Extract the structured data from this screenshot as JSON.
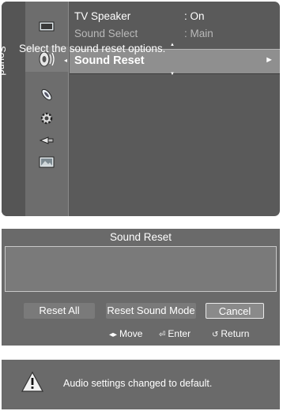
{
  "menu": {
    "category": "Sound",
    "icons": [
      "picture-icon",
      "sound-icon",
      "channel-icon",
      "setup-icon",
      "input-icon",
      "application-icon"
    ],
    "active_icon": "sound-icon",
    "items": [
      {
        "label": "TV Speaker",
        "value": ": On"
      },
      {
        "label": "Sound Select",
        "value": ": Main"
      }
    ],
    "selected": {
      "label": "Sound Reset",
      "arrow": "►"
    }
  },
  "dialog": {
    "title": "Sound Reset",
    "message": "Select the sound reset options.",
    "buttons": [
      "Reset All",
      "Reset Sound Mode",
      "Cancel"
    ],
    "focused_button": "Cancel",
    "hints": {
      "move": "Move",
      "enter": "Enter",
      "return": "Return"
    }
  },
  "notice": {
    "text": "Audio settings changed to default."
  },
  "colors": {
    "panel": "#6a6a6a",
    "highlight": "#8f8f8f",
    "text": "#ffffff"
  }
}
